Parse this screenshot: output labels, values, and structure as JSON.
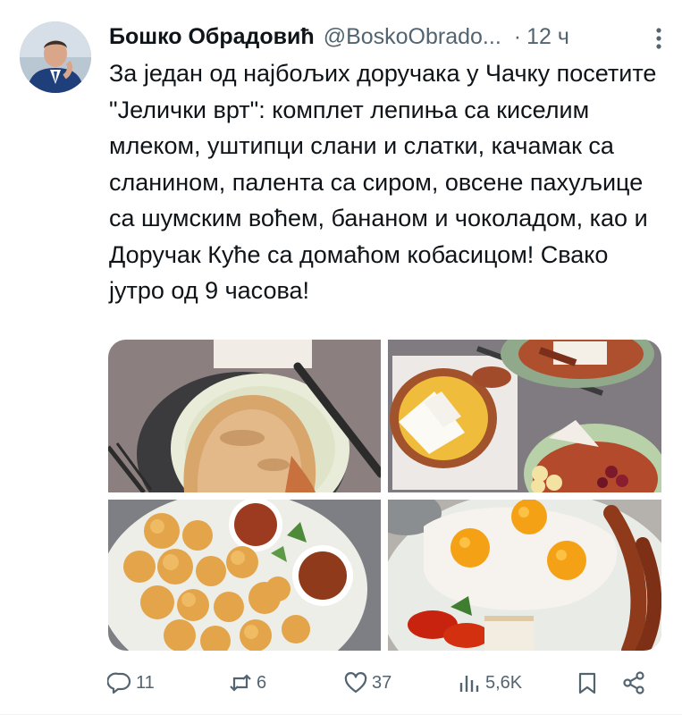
{
  "author": {
    "name": "Бошко Обрадовић",
    "handle": "@BoskoObrado...",
    "separator": "·",
    "time": "12 ч"
  },
  "tweet": {
    "text": "За један од најбољих доручака у Чачку посетите \"Јелички врт\":  комплет лепиња са киселим млеком, уштипци слани и слатки, качамак са сланином, палента са сиром, овсене пахуљице са шумским воћем, бананом и чоколадом, као и Доручак Куће са домаћом кобасицом! Свако јутро од 9 часова!"
  },
  "actions": {
    "replies": "11",
    "retweets": "6",
    "likes": "37",
    "views": "5,6K"
  },
  "icons": [
    "more-vertical-icon",
    "reply-icon",
    "retweet-icon",
    "like-icon",
    "views-icon",
    "bookmark-icon",
    "share-icon"
  ],
  "colors": {
    "text": "#0f1419",
    "muted": "#536471"
  }
}
